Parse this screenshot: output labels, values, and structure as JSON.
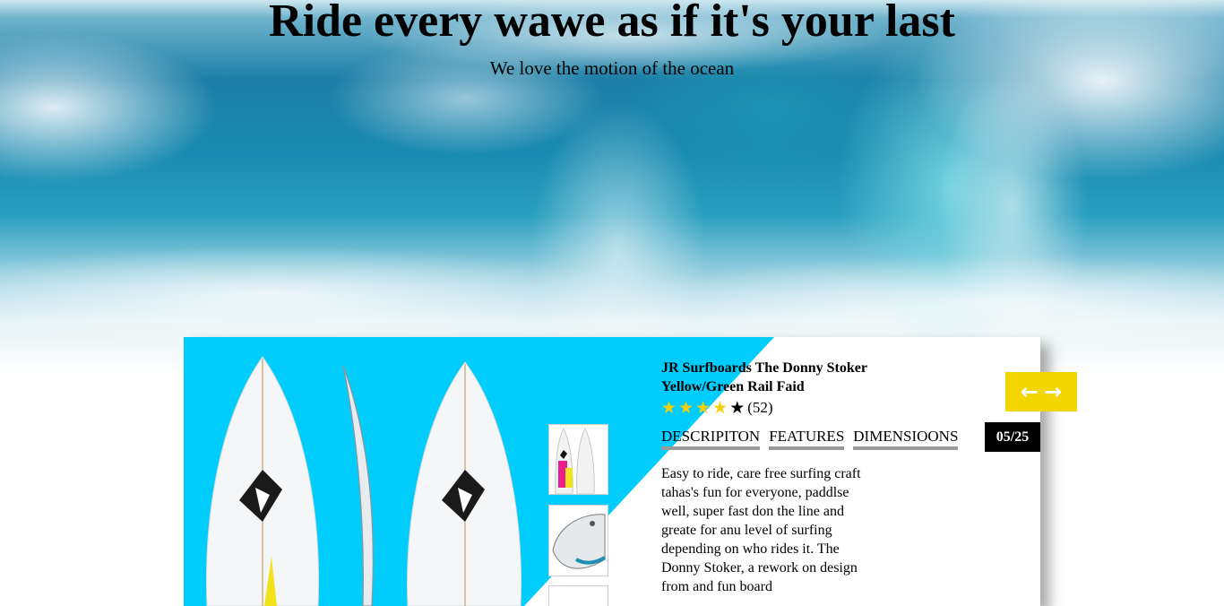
{
  "hero": {
    "title": "Ride every wawe as if it's your last",
    "subtitle": "We love the motion of the ocean"
  },
  "product": {
    "title": "JR Surfboards The Donny Stoker Yellow/Green Rail Faid",
    "rating": {
      "stars_filled": 4,
      "stars_total": 5,
      "count_label": "(52)"
    },
    "tabs": [
      {
        "label": "DESCRIPITON"
      },
      {
        "label": "FEATURES"
      },
      {
        "label": "DIMENSIOONS"
      }
    ],
    "page_counter": "05/25",
    "description": "Easy to ride, care free surfing craft tahas's fun for everyone, paddlse well, super fast don the line and greate for anu level of surfing depending on who rides it. The Donny Stoker, a rework on design from and fun board"
  },
  "navigation": {
    "prev_icon": "arrow-left-icon",
    "next_icon": "arrow-right-icon"
  },
  "colors": {
    "accent_blue": "#00cdfc",
    "nav_yellow": "#f2d501",
    "star_yellow": "#f5d00a",
    "counter_bg": "#000000"
  }
}
